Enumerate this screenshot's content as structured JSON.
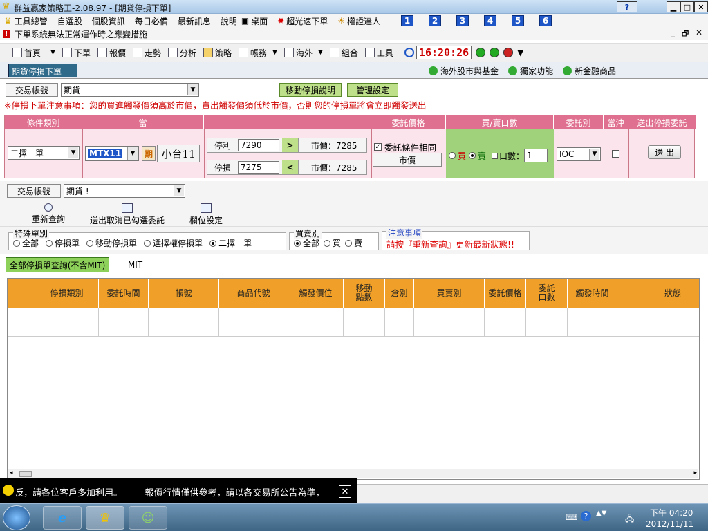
{
  "window": {
    "title": "群益贏家策略王-2.08.97 - [期貨停損下單]",
    "help": "?",
    "minimize": "▁",
    "restore": "□",
    "close": "✕",
    "child_min": "_",
    "child_restore": "🗗",
    "child_close": "✕"
  },
  "menu": {
    "items": [
      "工具總管",
      "自選股",
      "個股資訊",
      "每日必備",
      "最新訊息",
      "說明",
      "桌面",
      "超光速下單",
      "權證達人"
    ],
    "numbers": [
      "1",
      "2",
      "3",
      "4",
      "5",
      "6"
    ]
  },
  "notice_bar": "下單系統無法正常運作時之應變措施",
  "toolbar": {
    "items": [
      "首頁",
      "下單",
      "報價",
      "走勢",
      "分析",
      "策略",
      "帳務",
      "海外",
      "組合",
      "工具"
    ],
    "clock": "16:20:26",
    "more": "▼"
  },
  "tabs": {
    "active": "期貨停損下單",
    "right": [
      "海外股市與基金",
      "獨家功能",
      "新金融商品"
    ]
  },
  "account_row": {
    "label": "交易帳號",
    "value": "期貨",
    "btn_move": "移動停損說明",
    "btn_manage": "管理設定"
  },
  "warning": "※停損下單注意事項：您的買進觸發價須高於市價，賣出觸發價須低於市價，否則您的停損單將會立即觸發送出",
  "order_panel": {
    "headers": [
      "條件類別",
      "當",
      "",
      "委託價格",
      "買/賣口數",
      "委託別",
      "當沖",
      "送出停損委託"
    ],
    "cond_type": "二擇一單",
    "symbol": "MTX11",
    "period_btn": "期",
    "symbol_name": "小台11",
    "take_profit_label": "停利",
    "take_profit_value": "7290",
    "tp_op": ">",
    "tp_market": "市價：7285",
    "stop_loss_label": "停損",
    "stop_loss_value": "7275",
    "sl_op": "<",
    "sl_market": "市價：7285",
    "same_cond": "委託條件相同",
    "price_type": "市價",
    "buy": "買",
    "sell": "賣",
    "qty_label": "口數：",
    "qty": "1",
    "order_type": "IOC",
    "send": "送 出"
  },
  "query": {
    "account_label": "交易帳號",
    "account_value": "期貨 !",
    "tools": [
      "重新查詢",
      "送出取消已勾選委託",
      "欄位設定"
    ],
    "special_group": "特殊單別",
    "special_opts": [
      "全部",
      "停損單",
      "移動停損單",
      "選擇權停損單",
      "二擇一單"
    ],
    "side_group": "買賣別",
    "side_opts": [
      "全部",
      "買",
      "賣"
    ],
    "notice_title": "注意事項",
    "notice_text": "請按『重新查詢』更新最新狀態!!"
  },
  "query_tabs": [
    "全部停損單查詢(不含MIT)",
    "MIT"
  ],
  "grid_headers": [
    "停損類別",
    "委託時間",
    "帳號",
    "商品代號",
    "觸發價位",
    "移動\n點數",
    "倉別",
    "買賣別",
    "委託價格",
    "委託\n口數",
    "觸發時間",
    "狀態"
  ],
  "ticker": "，請各位客戶多加利用。　　　報價行情僅供參考，請以各交易所公告為準，",
  "ticker_prefix": "反",
  "taskbar": {
    "time": "下午 04:20",
    "date": "2012/11/11"
  },
  "colors": {
    "header_pink": "#e07090",
    "panel_pink": "#fbe4ec",
    "grid_orange": "#f0a028",
    "green": "#9fd27a",
    "clock_red": "#cc0000"
  }
}
